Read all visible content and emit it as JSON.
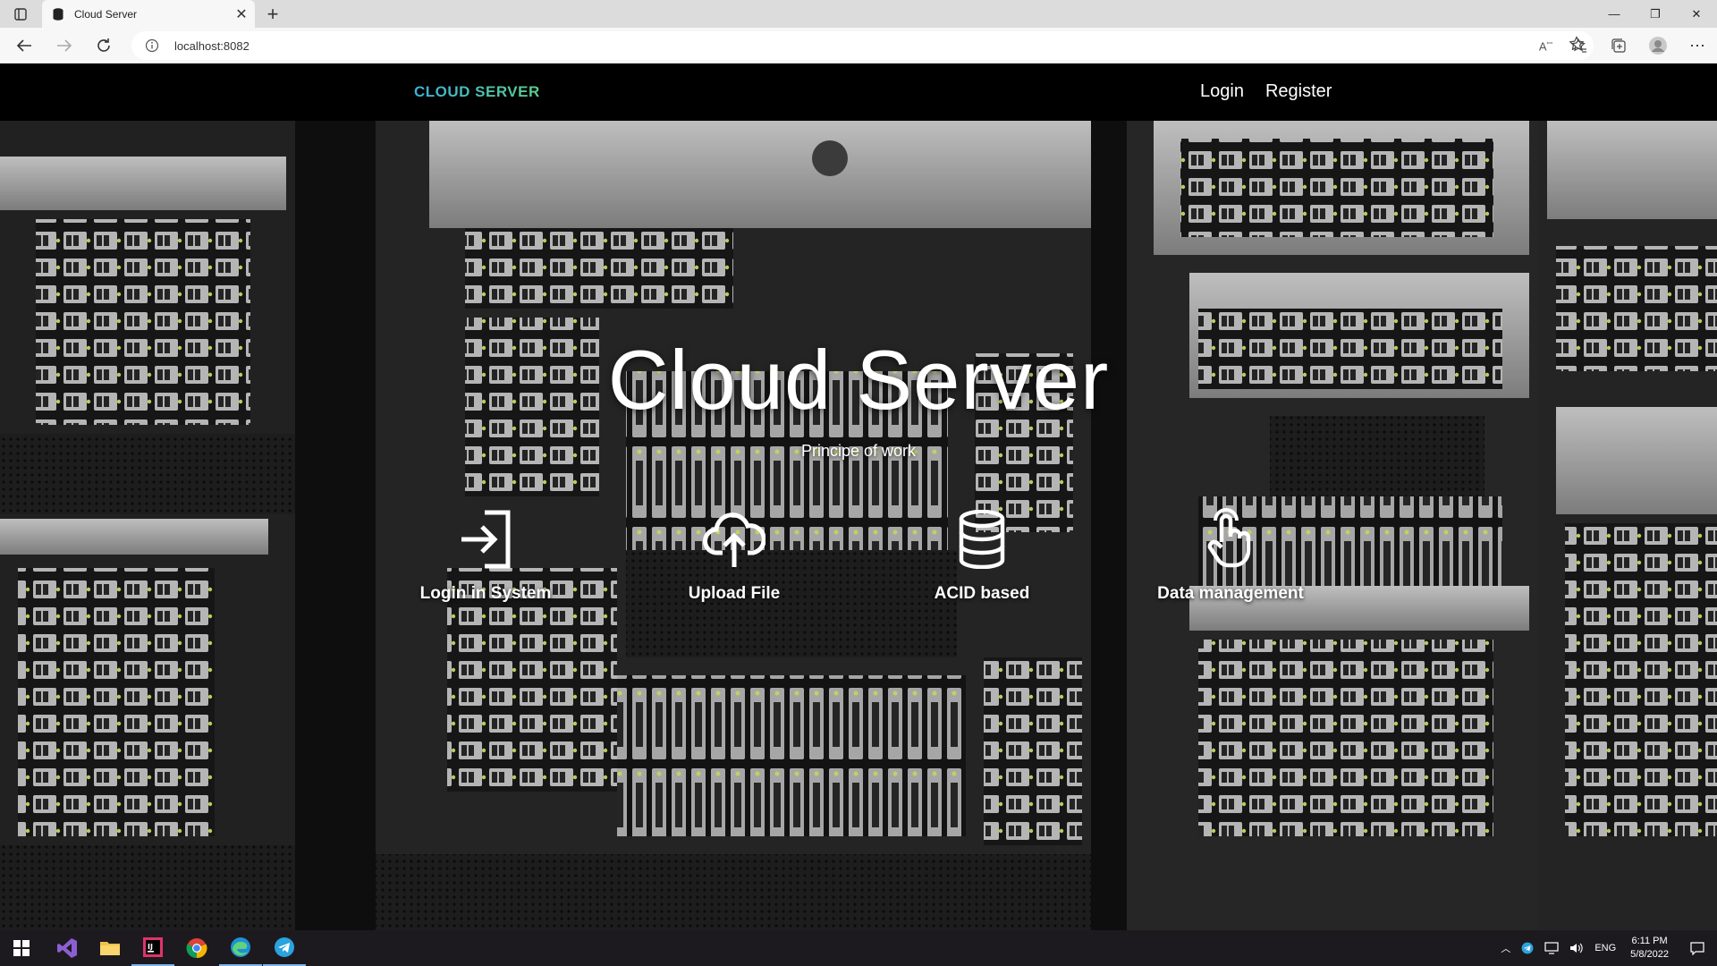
{
  "browser": {
    "tab_title": "Cloud Server",
    "address": "localhost:8082"
  },
  "navbar": {
    "brand": "CLOUD SERVER",
    "links": [
      {
        "label": "Login"
      },
      {
        "label": "Register"
      }
    ]
  },
  "hero": {
    "title": "Cloud Server",
    "subtitle": "Principe of work",
    "features": [
      {
        "label": "Login in System",
        "icon": "login-icon"
      },
      {
        "label": "Upload File",
        "icon": "cloud-upload-icon"
      },
      {
        "label": "ACID based",
        "icon": "database-icon"
      },
      {
        "label": "Data management",
        "icon": "hand-pointer-icon"
      }
    ]
  },
  "taskbar": {
    "apps": [
      "windows-start",
      "visual-studio",
      "file-explorer",
      "intellij",
      "chrome",
      "edge",
      "telegram"
    ],
    "language": "ENG",
    "time": "6:11 PM",
    "date": "5/8/2022"
  },
  "colors": {
    "brand_gradient_start": "#3fb0d8",
    "brand_gradient_end": "#5bcf8f",
    "navbar_bg": "#000000"
  }
}
